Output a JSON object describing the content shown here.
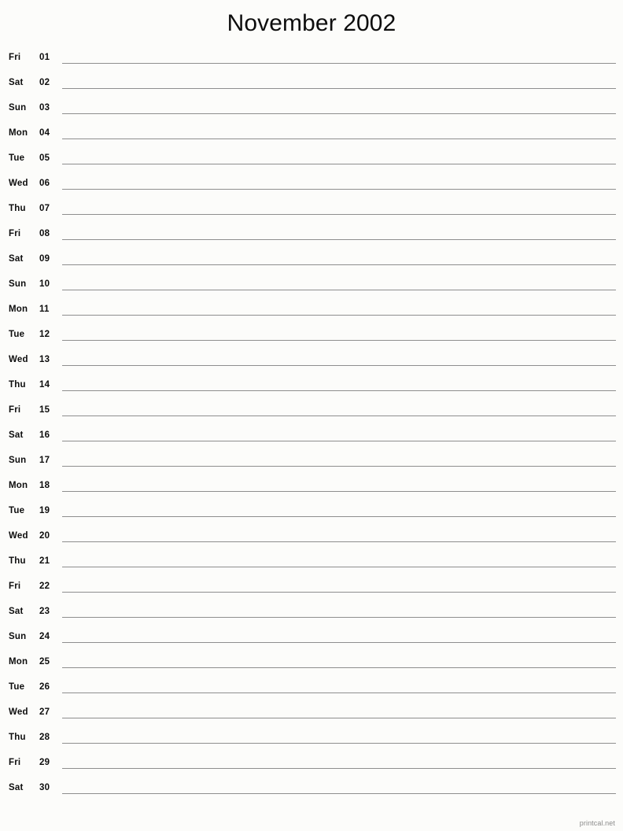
{
  "document": {
    "title": "November 2002",
    "month": "November",
    "year": "2002"
  },
  "footer": {
    "credit": "printcal.net"
  },
  "days": [
    {
      "weekday": "Fri",
      "number": "01"
    },
    {
      "weekday": "Sat",
      "number": "02"
    },
    {
      "weekday": "Sun",
      "number": "03"
    },
    {
      "weekday": "Mon",
      "number": "04"
    },
    {
      "weekday": "Tue",
      "number": "05"
    },
    {
      "weekday": "Wed",
      "number": "06"
    },
    {
      "weekday": "Thu",
      "number": "07"
    },
    {
      "weekday": "Fri",
      "number": "08"
    },
    {
      "weekday": "Sat",
      "number": "09"
    },
    {
      "weekday": "Sun",
      "number": "10"
    },
    {
      "weekday": "Mon",
      "number": "11"
    },
    {
      "weekday": "Tue",
      "number": "12"
    },
    {
      "weekday": "Wed",
      "number": "13"
    },
    {
      "weekday": "Thu",
      "number": "14"
    },
    {
      "weekday": "Fri",
      "number": "15"
    },
    {
      "weekday": "Sat",
      "number": "16"
    },
    {
      "weekday": "Sun",
      "number": "17"
    },
    {
      "weekday": "Mon",
      "number": "18"
    },
    {
      "weekday": "Tue",
      "number": "19"
    },
    {
      "weekday": "Wed",
      "number": "20"
    },
    {
      "weekday": "Thu",
      "number": "21"
    },
    {
      "weekday": "Fri",
      "number": "22"
    },
    {
      "weekday": "Sat",
      "number": "23"
    },
    {
      "weekday": "Sun",
      "number": "24"
    },
    {
      "weekday": "Mon",
      "number": "25"
    },
    {
      "weekday": "Tue",
      "number": "26"
    },
    {
      "weekday": "Wed",
      "number": "27"
    },
    {
      "weekday": "Thu",
      "number": "28"
    },
    {
      "weekday": "Fri",
      "number": "29"
    },
    {
      "weekday": "Sat",
      "number": "30"
    }
  ],
  "colors": {
    "background": "#fcfcfa",
    "text": "#0d0d0d",
    "rule": "#8e8e8e",
    "footer_text": "#8b8b8b"
  }
}
